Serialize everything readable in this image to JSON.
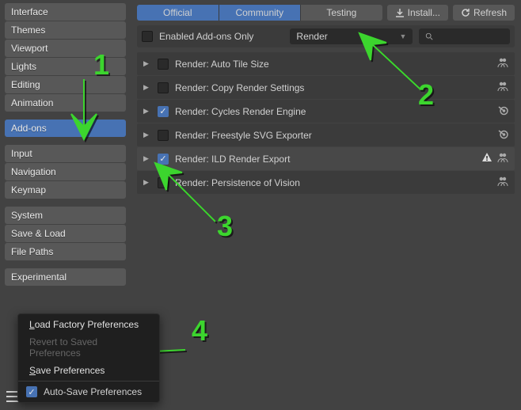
{
  "sidebar": {
    "items_g1": [
      "Interface",
      "Themes",
      "Viewport",
      "Lights",
      "Editing",
      "Animation"
    ],
    "active": "Add-ons",
    "items_g2": [
      "Input",
      "Navigation",
      "Keymap"
    ],
    "items_g3": [
      "System",
      "Save & Load",
      "File Paths"
    ],
    "items_g4": [
      "Experimental"
    ]
  },
  "toolbar": {
    "tabs": [
      "Official",
      "Community",
      "Testing"
    ],
    "active_tabs": [
      0,
      1
    ],
    "install": "Install...",
    "refresh": "Refresh"
  },
  "filter": {
    "enabled_only": "Enabled Add-ons Only",
    "category": "Render"
  },
  "addons": [
    {
      "name": "Render: Auto Tile Size",
      "checked": false,
      "icons": [
        "community"
      ]
    },
    {
      "name": "Render: Copy Render Settings",
      "checked": false,
      "icons": [
        "community"
      ]
    },
    {
      "name": "Render: Cycles Render Engine",
      "checked": true,
      "icons": [
        "blender"
      ]
    },
    {
      "name": "Render: Freestyle SVG Exporter",
      "checked": false,
      "icons": [
        "blender"
      ]
    },
    {
      "name": "Render: ILD Render Export",
      "checked": true,
      "selected": true,
      "icons": [
        "warning",
        "community"
      ]
    },
    {
      "name": "Render: Persistence of Vision",
      "checked": false,
      "icons": [
        "community"
      ]
    }
  ],
  "menu": {
    "load_factory": "Load Factory Preferences",
    "revert": "Revert to Saved Preferences",
    "save": "Save Preferences",
    "autosave": "Auto-Save Preferences"
  },
  "annotations": {
    "colors": {
      "arrow": "#3cd52e"
    }
  }
}
